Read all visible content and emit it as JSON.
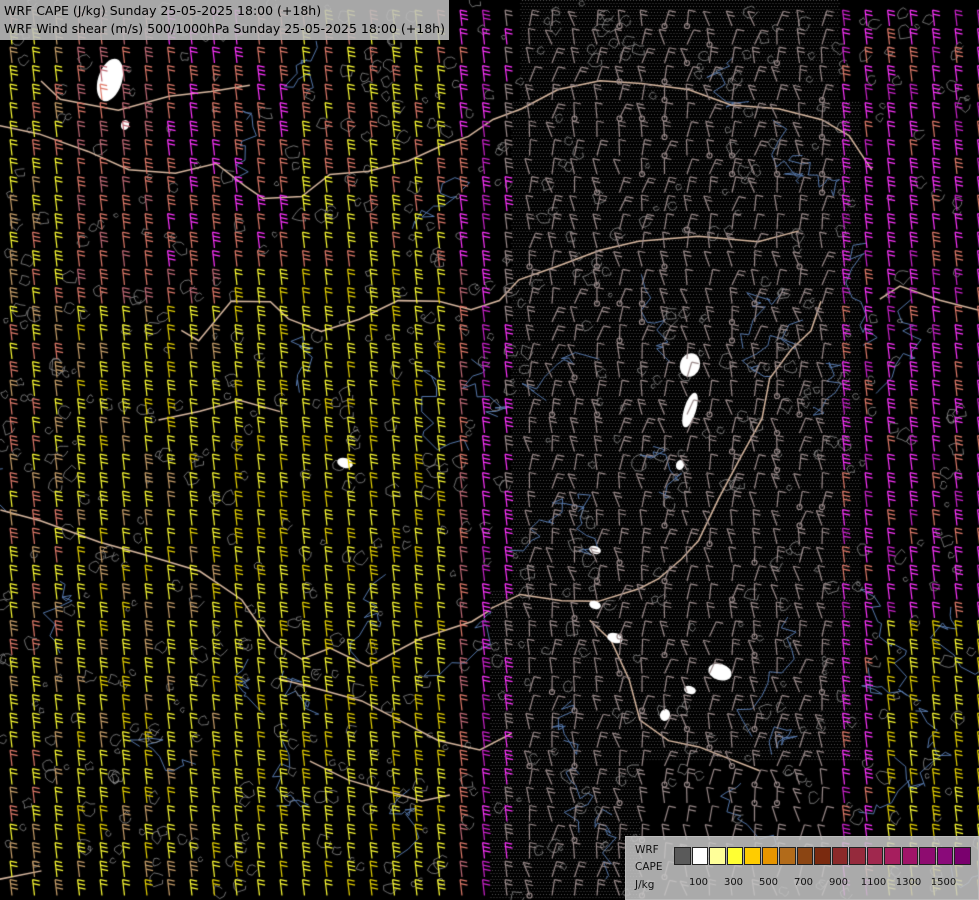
{
  "titles": {
    "line1": "WRF CAPE (J/kg) Sunday 25-05-2025 18:00 (+18h)",
    "line2": "WRF Wind shear (m/s) 500/1000hPa Sunday 25-05-2025 18:00 (+18h)"
  },
  "legend": {
    "label_line1": "WRF",
    "label_line2": "CAPE",
    "label_line3": "J/kg",
    "colors": [
      "#5a5a5a",
      "#ffffff",
      "#ffff99",
      "#ffff33",
      "#ffcc00",
      "#e69500",
      "#b26b1a",
      "#8b4513",
      "#7a2a0f",
      "#8b2a2a",
      "#952a3c",
      "#a0284e",
      "#a61e5e",
      "#a01468",
      "#8e0c70",
      "#8a0a7a",
      "#7a006e"
    ],
    "ticks": [
      "100",
      "300",
      "500",
      "700",
      "900",
      "1100",
      "1300",
      "1500"
    ]
  },
  "palette": {
    "yellow": "#ffff33",
    "gold": "#e6d200",
    "tan": "#c9a06a",
    "salmon": "#e07a6a",
    "rose": "#c06a76",
    "magenta": "#ff33ff",
    "violet": "#cc22cc",
    "grey_barb": "#9a8a8a",
    "border": "#d8b8a0",
    "river": "#5577aa",
    "contour": "#888888"
  }
}
